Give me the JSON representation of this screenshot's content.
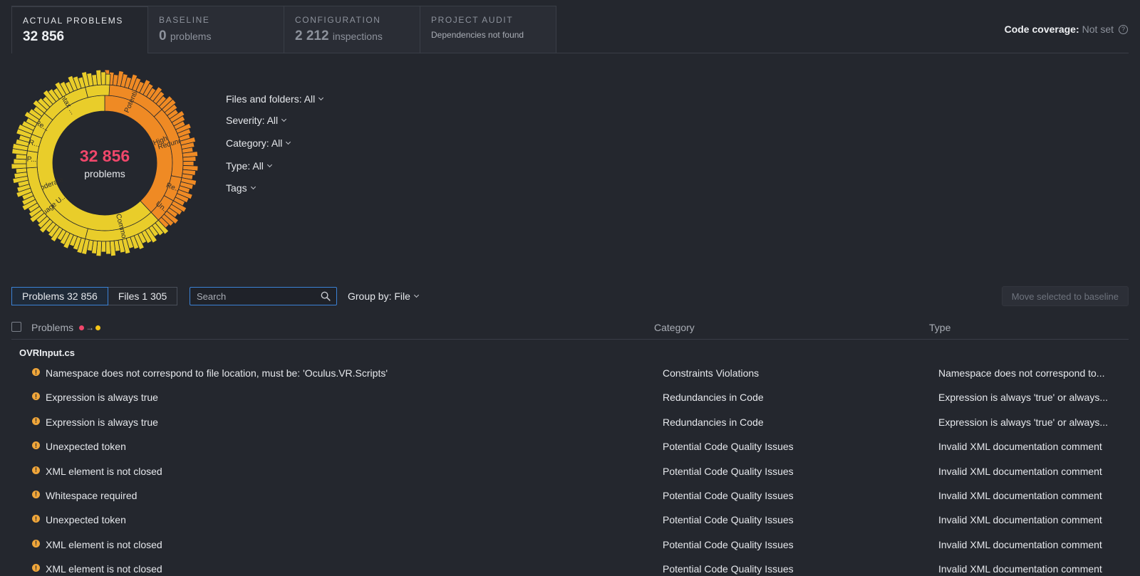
{
  "tabs": [
    {
      "title": "ACTUAL PROBLEMS",
      "value": "32 856",
      "unit": "",
      "sub": ""
    },
    {
      "title": "BASELINE",
      "value": "0",
      "unit": "problems",
      "sub": ""
    },
    {
      "title": "CONFIGURATION",
      "value": "2 212",
      "unit": "inspections",
      "sub": ""
    },
    {
      "title": "PROJECT AUDIT",
      "value": "",
      "unit": "",
      "sub": "Dependencies not found"
    }
  ],
  "coverage": {
    "label": "Code coverage:",
    "value": "Not set"
  },
  "donut": {
    "count": "32 856",
    "label": "problems",
    "severity": [
      {
        "name": "High",
        "fraction": 0.38,
        "color": "#ef8a24"
      },
      {
        "name": "Moderate",
        "fraction": 0.62,
        "color": "#e9cd2a"
      }
    ],
    "categories": [
      {
        "label": "Potential ...",
        "fraction": 0.13,
        "color": "#ef8a24"
      },
      {
        "label": "Redunda...",
        "fraction": 0.15,
        "color": "#ef8a24"
      },
      {
        "label": "Re...",
        "fraction": 0.05,
        "color": "#ef8a24"
      },
      {
        "label": "Un...",
        "fraction": 0.05,
        "color": "#ef8a24"
      },
      {
        "label": "Common P...",
        "fraction": 0.16,
        "color": "#e9cd2a"
      },
      {
        "label": "Language U...",
        "fraction": 0.2,
        "color": "#e9cd2a"
      },
      {
        "label": "P...",
        "fraction": 0.035,
        "color": "#e9cd2a"
      },
      {
        "label": "R...",
        "fraction": 0.035,
        "color": "#e9cd2a"
      },
      {
        "label": "Re...",
        "fraction": 0.05,
        "color": "#e9cd2a"
      },
      {
        "label": "Syntax ...",
        "fraction": 0.1,
        "color": "#e9cd2a"
      },
      {
        "label": "",
        "fraction": 0.05,
        "color": "#e9cd2a"
      }
    ]
  },
  "filters": [
    {
      "label": "Files and folders: All"
    },
    {
      "label": "Severity: All"
    },
    {
      "label": "Category: All"
    },
    {
      "label": "Type: All"
    },
    {
      "label": "Tags"
    }
  ],
  "toggle": {
    "problems": "Problems 32 856",
    "files": "Files 1 305"
  },
  "search": {
    "placeholder": "Search"
  },
  "groupby": "Group by: File",
  "move_button": "Move selected to baseline",
  "table": {
    "headers": {
      "problems": "Problems",
      "category": "Category",
      "type": "Type"
    },
    "file": "OVRInput.cs",
    "rows": [
      {
        "problem": "Namespace does not correspond to file location, must be: 'Oculus.VR.Scripts'",
        "category": "Constraints Violations",
        "type": "Namespace does not correspond to..."
      },
      {
        "problem": "Expression is always true",
        "category": "Redundancies in Code",
        "type": "Expression is always 'true' or always..."
      },
      {
        "problem": "Expression is always true",
        "category": "Redundancies in Code",
        "type": "Expression is always 'true' or always..."
      },
      {
        "problem": "Unexpected token",
        "category": "Potential Code Quality Issues",
        "type": "Invalid XML documentation comment"
      },
      {
        "problem": "XML element is not closed",
        "category": "Potential Code Quality Issues",
        "type": "Invalid XML documentation comment"
      },
      {
        "problem": "Whitespace required",
        "category": "Potential Code Quality Issues",
        "type": "Invalid XML documentation comment"
      },
      {
        "problem": "Unexpected token",
        "category": "Potential Code Quality Issues",
        "type": "Invalid XML documentation comment"
      },
      {
        "problem": "XML element is not closed",
        "category": "Potential Code Quality Issues",
        "type": "Invalid XML documentation comment"
      },
      {
        "problem": "XML element is not closed",
        "category": "Potential Code Quality Issues",
        "type": "Invalid XML documentation comment"
      }
    ]
  }
}
